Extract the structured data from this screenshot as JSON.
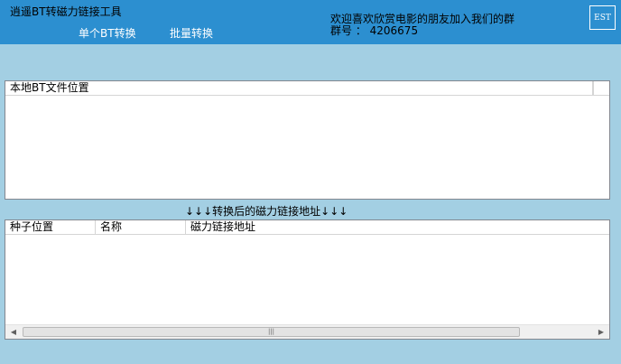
{
  "app": {
    "title": "逍遥BT转磁力链接工具"
  },
  "nav": [
    {
      "label": "单个BT转换"
    },
    {
      "label": "批量转换"
    }
  ],
  "welcome": {
    "line1": "欢迎喜欢欣赏电影的朋友加入我们的群",
    "line2": "群号 ： 4206675"
  },
  "est_button": {
    "label": "EST"
  },
  "local_panel": {
    "columns": [
      {
        "label": "本地BT文件位置"
      }
    ]
  },
  "caption": {
    "text": "↓↓↓转换后的磁力链接地址↓↓↓"
  },
  "result_panel": {
    "columns": [
      {
        "label": "种子位置"
      },
      {
        "label": "名称"
      },
      {
        "label": "磁力链接地址"
      }
    ]
  },
  "scrollbar": {
    "left_icon": "triangle-left",
    "right_icon": "triangle-right",
    "grip_icon": "grip-lines"
  }
}
